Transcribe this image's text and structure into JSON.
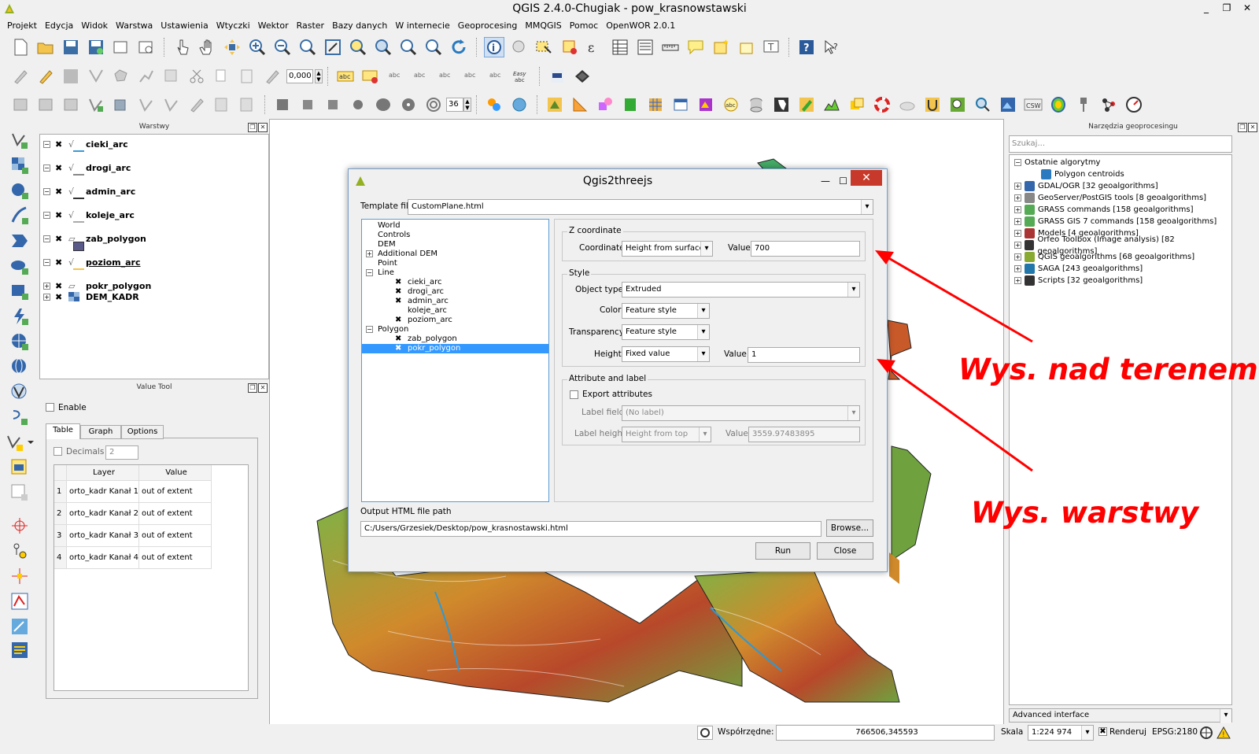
{
  "window": {
    "title": "QGIS 2.4.0-Chugiak - pow_krasnowstawski",
    "minimize": "_",
    "restore": "❐",
    "close": "✕"
  },
  "menu": [
    "Projekt",
    "Edycja",
    "Widok",
    "Warstwa",
    "Ustawienia",
    "Wtyczki",
    "Wektor",
    "Raster",
    "Bazy danych",
    "W internecie",
    "Geoprocesing",
    "MMQGIS",
    "Pomoc",
    "OpenWOR 2.0.1"
  ],
  "toolbar2": {
    "scale_value": "0,000"
  },
  "toolbar3": {
    "spin_value": "36"
  },
  "layers_panel": {
    "title": "Warstwy",
    "layers": [
      {
        "name": "cieki_arc",
        "checked": true,
        "underline": false
      },
      {
        "name": "drogi_arc",
        "checked": true,
        "underline": false
      },
      {
        "name": "admin_arc",
        "checked": true,
        "underline": false
      },
      {
        "name": "koleje_arc",
        "checked": true,
        "underline": false
      },
      {
        "name": "zab_polygon",
        "checked": true,
        "underline": false
      },
      {
        "name": "poziom_arc",
        "checked": true,
        "underline": true
      },
      {
        "name": "pokr_polygon",
        "checked": true,
        "underline": false
      },
      {
        "name": "DEM_KADR",
        "checked": true,
        "underline": false
      }
    ]
  },
  "value_tool": {
    "title": "Value Tool",
    "enable_label": "Enable",
    "tabs": [
      "Table",
      "Graph",
      "Options"
    ],
    "decimals_label": "Decimals",
    "decimals_value": "2",
    "columns": [
      "Layer",
      "Value"
    ],
    "rows": [
      {
        "n": "1",
        "layer": "orto_kadr Kanał 1",
        "value": "out of extent"
      },
      {
        "n": "2",
        "layer": "orto_kadr Kanał 2",
        "value": "out of extent"
      },
      {
        "n": "3",
        "layer": "orto_kadr Kanał 3",
        "value": "out of extent"
      },
      {
        "n": "4",
        "layer": "orto_kadr Kanał 4",
        "value": "out of extent"
      }
    ]
  },
  "dialog": {
    "title": "Qgis2threejs",
    "template_label": "Template file",
    "template_value": "CustomPlane.html",
    "tree": {
      "world": "World",
      "controls": "Controls",
      "dem": "DEM",
      "additional_dem": "Additional DEM",
      "point": "Point",
      "line": "Line",
      "line_items": [
        {
          "name": "cieki_arc",
          "checked": true
        },
        {
          "name": "drogi_arc",
          "checked": true
        },
        {
          "name": "admin_arc",
          "checked": true
        },
        {
          "name": "koleje_arc",
          "checked": false
        },
        {
          "name": "poziom_arc",
          "checked": true
        }
      ],
      "polygon": "Polygon",
      "polygon_items": [
        {
          "name": "zab_polygon",
          "checked": true
        },
        {
          "name": "pokr_polygon",
          "checked": true
        }
      ]
    },
    "z_coord": {
      "group": "Z coordinate",
      "coordinate_label": "Coordinate",
      "coordinate_value": "Height from surface",
      "value_label": "Value",
      "value": "700"
    },
    "style": {
      "group": "Style",
      "object_type_label": "Object type",
      "object_type": "Extruded",
      "color_label": "Color",
      "color": "Feature style",
      "transparency_label": "Transparency",
      "transparency": "Feature style",
      "height_label": "Height",
      "height": "Fixed value",
      "value_label": "Value",
      "value": "1"
    },
    "attr": {
      "group": "Attribute and label",
      "export_label": "Export attributes",
      "label_field_label": "Label field",
      "label_field": "(No label)",
      "label_height_label": "Label height",
      "label_height": "Height from top",
      "value_label": "Value",
      "value": "3559.97483895"
    },
    "output_label": "Output HTML file path",
    "output_value": "C:/Users/Grzesiek/Desktop/pow_krasnostawski.html",
    "browse": "Browse...",
    "run": "Run",
    "close": "Close"
  },
  "processing_panel": {
    "title": "Narzędzia geoprocesingu",
    "search_placeholder": "Szukaj...",
    "items": [
      {
        "label": "Ostatnie algorytmy",
        "level": 0,
        "expander": "⊟"
      },
      {
        "label": "Polygon centroids",
        "level": 2,
        "expander": ""
      },
      {
        "label": "GDAL/OGR [32 geoalgorithms]",
        "level": 0,
        "expander": "⊞"
      },
      {
        "label": "GeoServer/PostGIS tools [8 geoalgorithms]",
        "level": 0,
        "expander": "⊞"
      },
      {
        "label": "GRASS commands [158 geoalgorithms]",
        "level": 0,
        "expander": "⊞"
      },
      {
        "label": "GRASS GIS 7 commands [158 geoalgorithms]",
        "level": 0,
        "expander": "⊞"
      },
      {
        "label": "Models [4 geoalgorithms]",
        "level": 0,
        "expander": "⊞"
      },
      {
        "label": "Orfeo Toolbox (Image analysis) [82 geoalgorithms]",
        "level": 0,
        "expander": "⊞"
      },
      {
        "label": "QGIS geoalgorithms [68 geoalgorithms]",
        "level": 0,
        "expander": "⊞"
      },
      {
        "label": "SAGA [243 geoalgorithms]",
        "level": 0,
        "expander": "⊞"
      },
      {
        "label": "Scripts [32 geoalgorithms]",
        "level": 0,
        "expander": "⊞"
      }
    ],
    "advanced": "Advanced interface"
  },
  "status": {
    "coords_label": "Współrzędne:",
    "coords_value": "766506,345593",
    "scale_label": "Skala",
    "scale_value": "1:224 974",
    "render_label": "Renderuj",
    "epsg": "EPSG:2180"
  },
  "annotations": {
    "above_terrain": "Wys. nad terenem",
    "layer_height": "Wys. warstwy"
  },
  "colors": {
    "accent": "#3399ff",
    "annotation": "#ff0000",
    "close_red": "#c73a2b"
  }
}
